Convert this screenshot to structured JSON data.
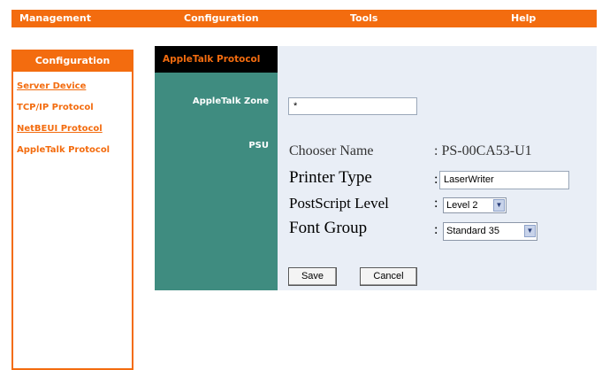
{
  "topnav": {
    "management": "Management",
    "configuration": "Configuration",
    "tools": "Tools",
    "help": "Help"
  },
  "sidebar": {
    "header": "Configuration",
    "items": [
      {
        "label": "Server Device"
      },
      {
        "label": "TCP/IP Protocol"
      },
      {
        "label": "NetBEUI Protocol"
      },
      {
        "label": "AppleTalk Protocol"
      }
    ]
  },
  "panel": {
    "title": "AppleTalk Protocol",
    "zone_label": "AppleTalk Zone",
    "zone_value": "*",
    "psu_label": "PSU",
    "chooser_name_label": "Chooser Name",
    "chooser_name_value": ": PS-00CA53-U1",
    "printer_type_label": "Printer Type",
    "printer_type_value": "LaserWriter",
    "postscript_level_label": "PostScript Level",
    "postscript_level_value": "Level 2",
    "font_group_label": "Font Group",
    "font_group_value": "Standard 35",
    "save_label": "Save",
    "cancel_label": "Cancel"
  },
  "colors": {
    "accent": "#f36c0f",
    "label_column": "#3f8c80",
    "panel_bg": "#e9eef6"
  }
}
